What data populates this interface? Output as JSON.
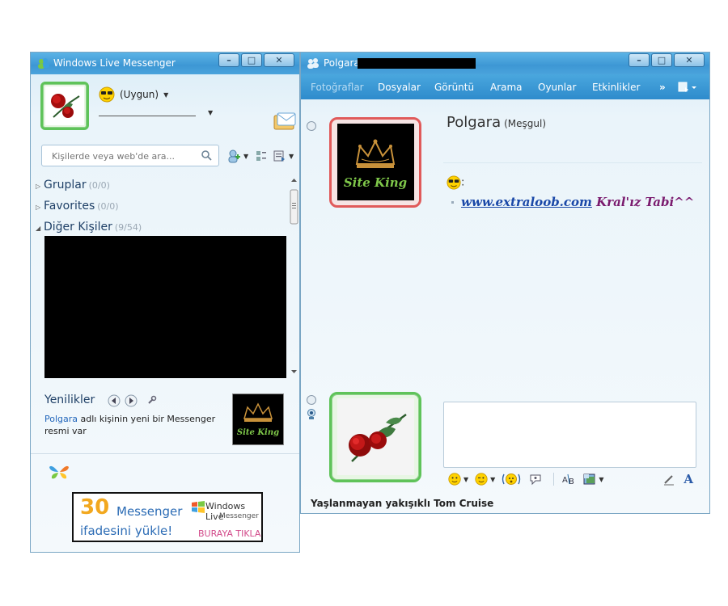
{
  "messenger": {
    "title": "Windows Live Messenger",
    "status_label": "(Uygun)",
    "search_placeholder": "Kişilerde veya web'de ara...",
    "groups": [
      {
        "label": "Gruplar",
        "count": "(0/0)",
        "expanded": false
      },
      {
        "label": "Favorites",
        "count": "(0/0)",
        "expanded": false
      },
      {
        "label": "Diğer Kişiler",
        "count": "(9/54)",
        "expanded": true
      }
    ],
    "news": {
      "title": "Yenilikler",
      "contact": "Polgara",
      "text": " adlı kişinin yeni bir Messenger resmi var"
    },
    "ad": {
      "number": "30",
      "word": "Messenger",
      "line2": "ifadesini yükle!",
      "brand": "Windows Live",
      "brand_sub": "Messenger",
      "cta": "BURAYA TIKLA"
    }
  },
  "conversation": {
    "title": "Polgara",
    "menu": [
      "Fotoğraflar",
      "Dosyalar",
      "Görüntü",
      "Arama",
      "Oyunlar",
      "Etkinlikler"
    ],
    "more": "»",
    "contact_name": "Polgara",
    "contact_status": "(Meşgul)",
    "message_prefix": ":",
    "message_url": "www.extraloob.com",
    "message_rest": " Kral'ız Tabi^^",
    "avatar_text": "Site King",
    "footer": "Yaşlanmayan yakışıklı Tom Cruise"
  },
  "colors": {
    "titlebar": "#3d97d4",
    "accent": "#2e8bcc",
    "online": "#5fc35a",
    "busy": "#e05a5a"
  }
}
